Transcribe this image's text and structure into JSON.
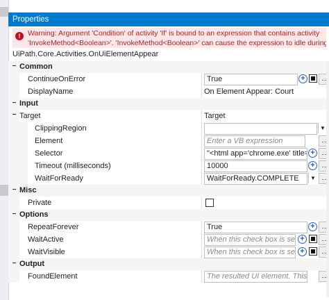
{
  "panel": {
    "title": "Properties",
    "warning": {
      "line1": "Warning: Argument 'Condition' of activity 'If' is bound to an expression that contains activity",
      "line2": "'InvokeMethod<Boolean>'. 'InvokeMethod<Boolean>' can cause the expression to idle during evaluation...."
    },
    "activity_type": "UiPath.Core.Activities.OnUiElementAppear"
  },
  "categories": {
    "common": "Common",
    "input": "Input",
    "misc": "Misc",
    "options": "Options",
    "output": "Output"
  },
  "props": {
    "continue_on_error": {
      "label": "ContinueOnError",
      "value": "True",
      "checked": true
    },
    "display_name": {
      "label": "DisplayName",
      "value": "On Element Appear: Court"
    },
    "target": {
      "label": "Target",
      "value": "Target"
    },
    "clipping_region": {
      "label": "ClippingRegion",
      "value": ""
    },
    "element": {
      "label": "Element",
      "placeholder": "Enter a VB expression"
    },
    "selector": {
      "label": "Selector",
      "value": "\"<html app='chrome.exe' title='ירה"
    },
    "timeout": {
      "label": "Timeout (milliseconds)",
      "value": "10000"
    },
    "wait_for_ready": {
      "label": "WaitForReady",
      "value": "WaitForReady.COMPLETE"
    },
    "private": {
      "label": "Private",
      "checked": false
    },
    "repeat_forever": {
      "label": "RepeatForever",
      "value": "True"
    },
    "wait_active": {
      "label": "WaitActive",
      "placeholder": "When this check box is selected, t"
    },
    "wait_visible": {
      "label": "WaitVisible",
      "placeholder": "When this check box is selected, t"
    },
    "found_element": {
      "label": "FoundElement",
      "placeholder": "The resulted UI element. This field su"
    }
  },
  "glyphs": {
    "collapse": "−",
    "expand": "+",
    "ellipsis": "...",
    "dropdown": "▼",
    "plus": "+",
    "warn": "!"
  },
  "colors": {
    "titlebar": "#007acc",
    "warning_bg": "#fde7e9",
    "warning_text": "#a4262c",
    "plus_icon": "#1f5fbf"
  }
}
